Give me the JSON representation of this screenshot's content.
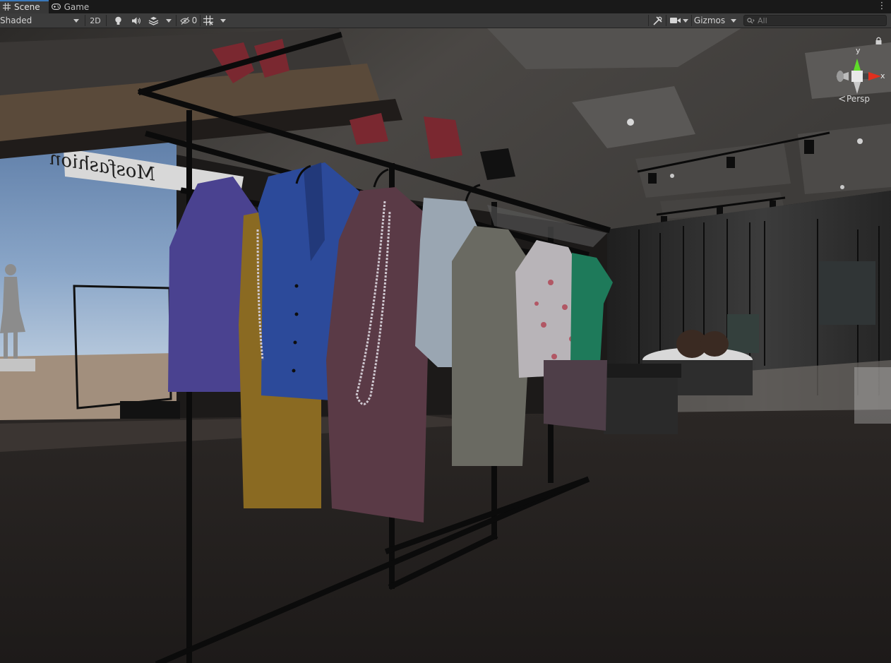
{
  "tabs": [
    {
      "label": "Scene",
      "icon": "grid-icon",
      "active": true
    },
    {
      "label": "Game",
      "icon": "gamepad-icon",
      "active": false
    }
  ],
  "toolbar": {
    "draw_mode": "Shaded",
    "mode_2d": "2D",
    "hidden_count": "0",
    "gizmos_label": "Gizmos",
    "search_placeholder": "All"
  },
  "viewport": {
    "projection_label": "Persp",
    "axes": {
      "y": "y",
      "x": "x"
    },
    "sign_text": "Mosfashion"
  },
  "colors": {
    "tab_accent": "#3a79bb",
    "toolbar_bg": "#3c3c3c",
    "axis_y": "#5fdc29",
    "axis_x": "#e0301e"
  }
}
